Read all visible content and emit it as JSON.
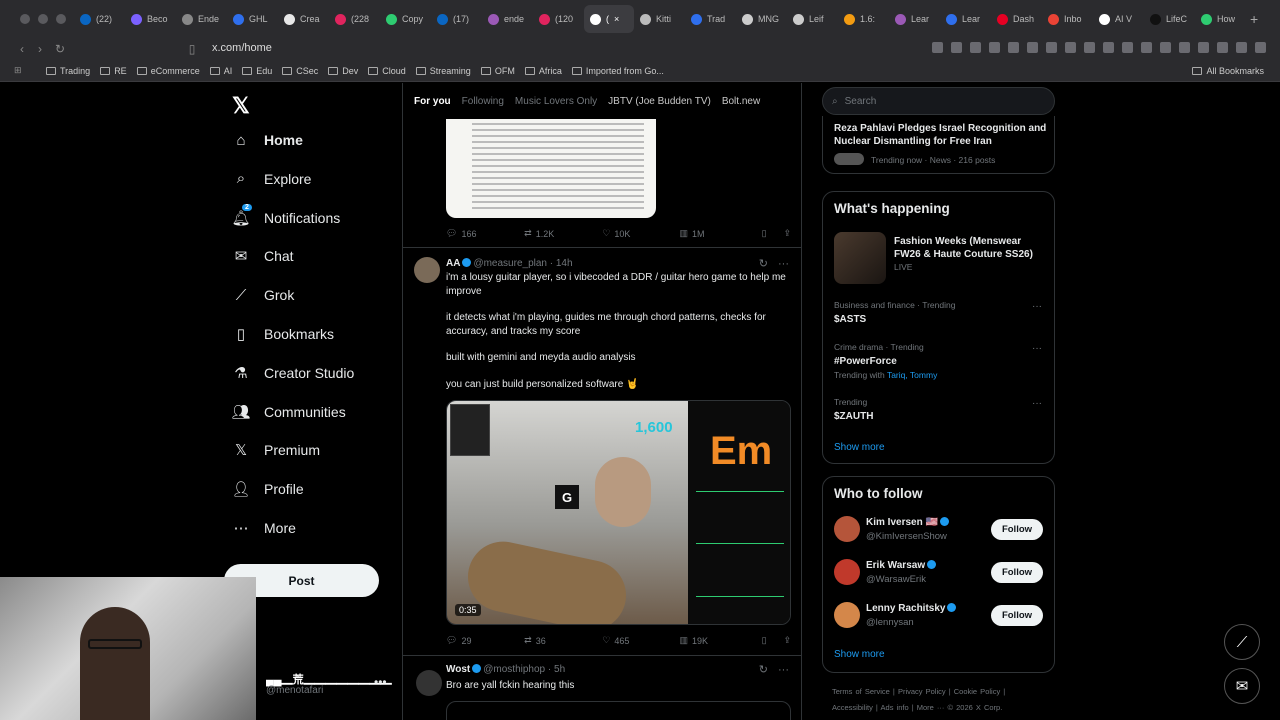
{
  "browser": {
    "tabs": [
      {
        "label": "(22)",
        "color": "#0a66c2"
      },
      {
        "label": "Beco",
        "color": "#7b61ff"
      },
      {
        "label": "Ende",
        "color": "#888888"
      },
      {
        "label": "GHL",
        "color": "#2f6fed"
      },
      {
        "label": "Crea",
        "color": "#e8e8e8"
      },
      {
        "label": "(228",
        "color": "#e0245e"
      },
      {
        "label": "Copy",
        "color": "#2ecc71"
      },
      {
        "label": "(17)",
        "color": "#0a66c2"
      },
      {
        "label": "ende",
        "color": "#9b59b6"
      },
      {
        "label": "(120",
        "color": "#e0245e"
      },
      {
        "label": "(",
        "color": "#ffffff",
        "active": true
      },
      {
        "label": "Kitti",
        "color": "#bbbbbb"
      },
      {
        "label": "Trad",
        "color": "#2f6fed"
      },
      {
        "label": "MNG",
        "color": "#cccccc"
      },
      {
        "label": "Leif",
        "color": "#cccccc"
      },
      {
        "label": "1.6:",
        "color": "#f39c12"
      },
      {
        "label": "Lear",
        "color": "#9b59b6"
      },
      {
        "label": "Lear",
        "color": "#2f6fed"
      },
      {
        "label": "Dash",
        "color": "#e60023"
      },
      {
        "label": "Inbo",
        "color": "#ea4335"
      },
      {
        "label": "AI V",
        "color": "#ffffff"
      },
      {
        "label": "LifeC",
        "color": "#111111"
      },
      {
        "label": "How",
        "color": "#2ecc71"
      }
    ],
    "url": "x.com/home",
    "bookmarks": [
      "Trading",
      "RE",
      "eCommerce",
      "AI",
      "Edu",
      "CSec",
      "Dev",
      "Cloud",
      "Streaming",
      "OFM",
      "Africa",
      "Imported from Go..."
    ],
    "all_bookmarks": "All Bookmarks"
  },
  "sidebar": {
    "items": [
      {
        "label": "Home",
        "icon": "home-icon"
      },
      {
        "label": "Explore",
        "icon": "search-icon"
      },
      {
        "label": "Notifications",
        "icon": "bell-icon"
      },
      {
        "label": "Chat",
        "icon": "mail-icon"
      },
      {
        "label": "Grok",
        "icon": "grok-icon"
      },
      {
        "label": "Bookmarks",
        "icon": "bookmark-icon"
      },
      {
        "label": "Creator Studio",
        "icon": "flask-icon"
      },
      {
        "label": "Communities",
        "icon": "people-icon"
      },
      {
        "label": "Premium",
        "icon": "x-icon"
      },
      {
        "label": "Profile",
        "icon": "person-icon"
      },
      {
        "label": "More",
        "icon": "more-circle-icon"
      }
    ],
    "notification_badge": "2",
    "post_label": "Post",
    "account_name": "▄▄▁荒▁▁▁▁▁▁▁▁",
    "account_handle": "@menotafari"
  },
  "timeline": {
    "tabs": [
      "For you",
      "Following",
      "Music Lovers Only",
      "JBTV (Joe Budden TV)",
      "Bolt.new"
    ],
    "tweet1_actions": {
      "replies": "166",
      "reposts": "1.2K",
      "likes": "10K",
      "views": "1M"
    },
    "tweet2": {
      "name": "AA",
      "handle": "@measure_plan",
      "time": "14h",
      "paragraphs": [
        "i'm a lousy guitar player, so i vibecoded a DDR / guitar hero game to help me improve",
        "it detects what i'm playing, guides me through chord patterns, checks for accuracy, and tracks my score",
        "built with gemini and meyda audio analysis",
        "you can just build personalized software 🤘"
      ],
      "video": {
        "duration": "0:35",
        "chord": "Em",
        "score": "1,600",
        "current_chord": "G"
      },
      "actions": {
        "replies": "29",
        "reposts": "36",
        "likes": "465",
        "views": "19K"
      }
    },
    "tweet3": {
      "name": "Wost",
      "handle": "@mosthiphop",
      "time": "5h",
      "text": "Bro are yall fckin hearing this"
    }
  },
  "right": {
    "search_placeholder": "Search",
    "top_trend": {
      "title": "Reza Pahlavi Pledges Israel Recognition and Nuclear Dismantling for Free Iran",
      "meta": "Trending now · News · 216 posts"
    },
    "whats_happening_title": "What's happening",
    "featured": {
      "title": "Fashion Weeks (Menswear FW26 & Haute Couture SS26)",
      "meta": "LIVE"
    },
    "trends": [
      {
        "meta": "Business and finance · Trending",
        "title": "$ASTS"
      },
      {
        "meta": "Crime drama · Trending",
        "title": "#PowerForce",
        "with_prefix": "Trending with",
        "with_names": "Tariq, Tommy"
      },
      {
        "meta": "Trending",
        "title": "$ZAUTH"
      }
    ],
    "show_more": "Show more",
    "who_to_follow_title": "Who to follow",
    "follow_suggestions": [
      {
        "name": "Kim Iversen 🇺🇸",
        "handle": "@KimIversenShow",
        "color": "#b5553a"
      },
      {
        "name": "Erik Warsaw",
        "handle": "@WarsawErik",
        "color": "#c0392b"
      },
      {
        "name": "Lenny Rachitsky",
        "handle": "@lennysan",
        "color": "#d4874a"
      }
    ],
    "follow_label": "Follow",
    "footer_line1": "Terms of Service  |  Privacy Policy  |  Cookie Policy  |",
    "footer_line2": "Accessibility  |  Ads info  |  More ···  © 2026 X Corp."
  }
}
